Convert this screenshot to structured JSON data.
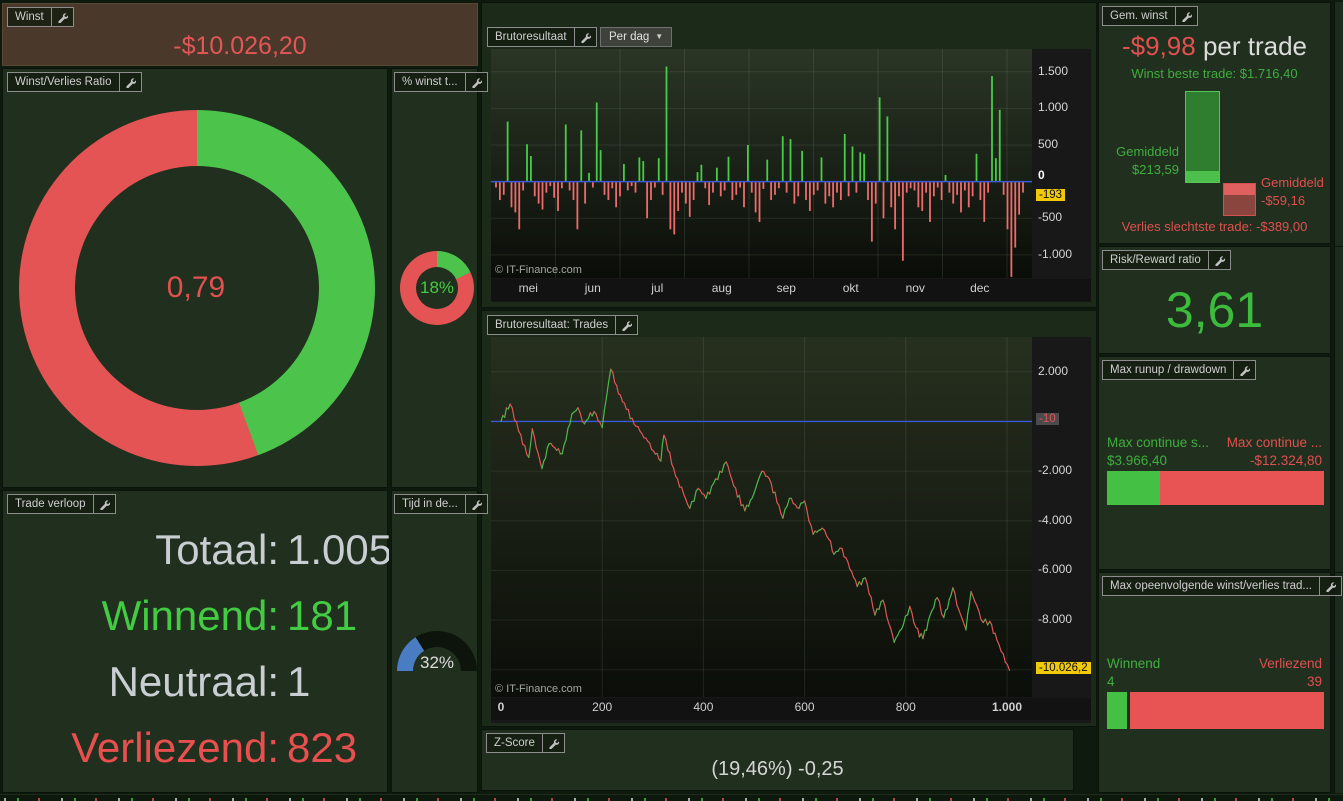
{
  "panels": {
    "winst": {
      "title": "Winst",
      "value": "-$10.026,20"
    },
    "ratio": {
      "title": "Winst/Verlies Ratio",
      "value": "0,79",
      "green_pct": 44.4,
      "red_pct": 55.6,
      "green_color": "#4cc44c",
      "red_color": "#e45454"
    },
    "pct_winst": {
      "title": "% winst t...",
      "value": "18%",
      "green_pct": 18
    },
    "trade_verloop": {
      "title": "Trade verloop",
      "rows": [
        {
          "label": "Totaal:",
          "value": "1.005",
          "color": "gray"
        },
        {
          "label": "Winnend:",
          "value": "181",
          "color": "green"
        },
        {
          "label": "Neutraal:",
          "value": "1",
          "color": "gray"
        },
        {
          "label": "Verliezend:",
          "value": "823",
          "color": "red"
        }
      ]
    },
    "tijd": {
      "title": "Tijd in de...",
      "value": "32%",
      "pct": 32,
      "blue_color": "#4a7cc4"
    },
    "z_score": {
      "title": "Z-Score",
      "value": "(19,46%) -0,25"
    },
    "gem_winst": {
      "title": "Gem. winst",
      "value": "-$9,98",
      "suffix": " per trade",
      "best_line": "Winst beste trade: $1.716,40",
      "avg_win_label": "Gemiddeld",
      "avg_win_value": "$213,59",
      "avg_loss_label": "Gemiddeld",
      "avg_loss_value": "-$59,16",
      "worst_line": "Verlies slechtste trade: -$389,00",
      "best": 1716.4,
      "avg_win": 213.59,
      "worst": -389.0,
      "avg_loss": -59.16
    },
    "risk_reward": {
      "title": "Risk/Reward ratio",
      "value": "3,61"
    },
    "runup": {
      "title": "Max runup / drawdown",
      "left_label": "Max continue s...",
      "left_value": "$3.966,40",
      "left_num": 3966.4,
      "right_label": "Max continue ...",
      "right_value": "-$12.324,80",
      "right_num": 12324.8
    },
    "consec": {
      "title": "Max opeenvolgende winst/verlies trad...",
      "left_label": "Winnend",
      "left_value": "4",
      "left_num": 4,
      "right_label": "Verliezend",
      "right_value": "39",
      "right_num": 39
    }
  },
  "charts": {
    "daily": {
      "title": "Brutoresultaat",
      "dropdown": "Per dag",
      "watermark": "© IT-Finance.com",
      "type": "bar",
      "months": [
        "mei",
        "jun",
        "jul",
        "aug",
        "sep",
        "okt",
        "nov",
        "dec"
      ],
      "ytick_values": [
        1500,
        1000,
        500,
        -500,
        -1000
      ],
      "ytick_labels": [
        "1.500",
        "1.000",
        "500",
        "-500",
        "-1.000"
      ],
      "zero_label": "0",
      "last_badge": "-193",
      "last_value": -193,
      "ylim": [
        -1315,
        1810
      ],
      "bar_green": "#48cc48",
      "bar_red": "#ef6b6b",
      "zero_line_color": "#3a57d8",
      "values": [
        -80,
        -250,
        -180,
        820,
        -350,
        -420,
        -650,
        -120,
        510,
        350,
        -200,
        -300,
        -380,
        -150,
        -60,
        -220,
        -400,
        -90,
        780,
        -120,
        -250,
        -650,
        700,
        -300,
        120,
        -80,
        1080,
        430,
        -180,
        -250,
        -90,
        -350,
        -200,
        240,
        -120,
        -60,
        -150,
        330,
        280,
        -500,
        -250,
        -80,
        320,
        -180,
        1570,
        -650,
        -720,
        -400,
        -150,
        -300,
        -480,
        -250,
        130,
        230,
        -90,
        -320,
        -150,
        190,
        -200,
        -120,
        340,
        -250,
        -180,
        -80,
        -350,
        500,
        -150,
        -420,
        -550,
        -100,
        300,
        -250,
        -180,
        -90,
        620,
        -150,
        580,
        -300,
        -200,
        420,
        -250,
        -400,
        -180,
        -120,
        330,
        -300,
        -200,
        -350,
        -150,
        -250,
        650,
        -200,
        480,
        -150,
        400,
        380,
        -250,
        -820,
        -300,
        1150,
        -500,
        890,
        -350,
        -650,
        -200,
        -1080,
        -150,
        -90,
        -120,
        -350,
        -400,
        -150,
        -550,
        -200,
        -80,
        -250,
        90,
        -150,
        -300,
        -180,
        -420,
        -120,
        -350,
        -200,
        380,
        -250,
        -550,
        -150,
        1440,
        320,
        980,
        -180,
        -650,
        -1300,
        -900,
        -450,
        -150
      ]
    },
    "equity": {
      "title": "Brutoresultaat: Trades",
      "watermark": "© IT-Finance.com",
      "type": "line",
      "xtick_values": [
        0,
        200,
        400,
        600,
        800,
        1000
      ],
      "xtick_labels": [
        "0",
        "200",
        "400",
        "600",
        "800",
        "1.000"
      ],
      "ytick_values": [
        2000,
        -2000,
        -4000,
        -6000,
        -8000
      ],
      "ytick_labels": [
        "2.000",
        "-2.000",
        "-4.000",
        "-6.000",
        "-8.000"
      ],
      "grid_extra": [
        -10000
      ],
      "zero_badge": "-10",
      "end_badge": "-10.026,2",
      "end_value": -10026,
      "ylim": [
        -11100,
        3400
      ],
      "xlim": [
        0,
        1005
      ],
      "line_green": "#4db84d",
      "line_red": "#e05555",
      "zero_line_color": "#3a57d8",
      "anchors": [
        [
          0,
          0
        ],
        [
          18,
          700
        ],
        [
          35,
          -400
        ],
        [
          55,
          -1450
        ],
        [
          62,
          -300
        ],
        [
          81,
          -1900
        ],
        [
          95,
          -900
        ],
        [
          121,
          -1300
        ],
        [
          140,
          300
        ],
        [
          152,
          550
        ],
        [
          165,
          -100
        ],
        [
          184,
          400
        ],
        [
          200,
          -250
        ],
        [
          217,
          2100
        ],
        [
          240,
          800
        ],
        [
          267,
          -200
        ],
        [
          290,
          -800
        ],
        [
          316,
          -1600
        ],
        [
          322,
          -550
        ],
        [
          345,
          -2200
        ],
        [
          373,
          -3500
        ],
        [
          390,
          -2700
        ],
        [
          405,
          -3100
        ],
        [
          420,
          -2500
        ],
        [
          445,
          -1630
        ],
        [
          460,
          -2600
        ],
        [
          482,
          -3600
        ],
        [
          500,
          -2900
        ],
        [
          516,
          -2000
        ],
        [
          530,
          -2300
        ],
        [
          557,
          -3900
        ],
        [
          570,
          -3100
        ],
        [
          589,
          -3500
        ],
        [
          600,
          -3200
        ],
        [
          617,
          -4550
        ],
        [
          635,
          -4300
        ],
        [
          648,
          -4750
        ],
        [
          658,
          -5350
        ],
        [
          670,
          -5100
        ],
        [
          682,
          -5500
        ],
        [
          704,
          -6650
        ],
        [
          720,
          -6300
        ],
        [
          739,
          -7800
        ],
        [
          755,
          -7200
        ],
        [
          777,
          -8900
        ],
        [
          795,
          -8200
        ],
        [
          808,
          -7450
        ],
        [
          820,
          -8300
        ],
        [
          834,
          -8750
        ],
        [
          848,
          -7800
        ],
        [
          862,
          -7100
        ],
        [
          875,
          -7900
        ],
        [
          893,
          -6700
        ],
        [
          905,
          -7600
        ],
        [
          919,
          -8400
        ],
        [
          929,
          -6850
        ],
        [
          940,
          -7400
        ],
        [
          953,
          -8100
        ],
        [
          966,
          -8050
        ],
        [
          980,
          -8800
        ],
        [
          1005,
          -10026
        ]
      ]
    }
  }
}
